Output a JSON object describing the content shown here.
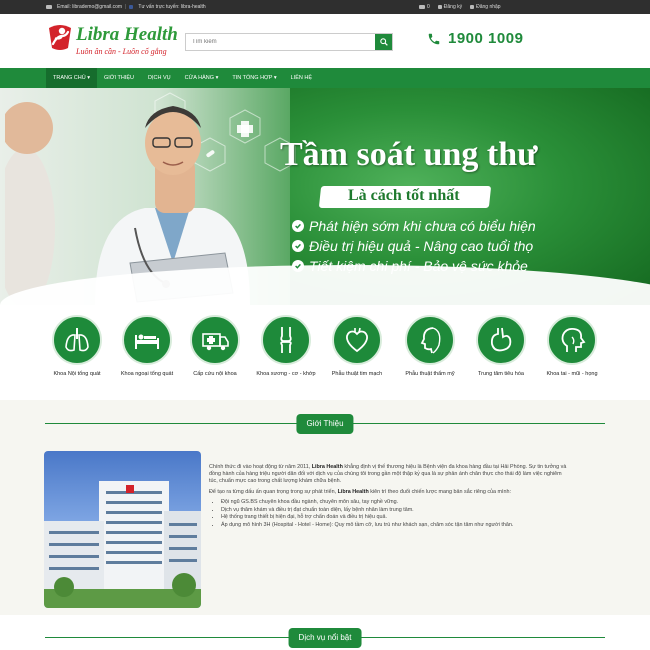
{
  "topbar": {
    "email": "Email: librademo@gmail.com",
    "separator": "|",
    "advice": "Tư vấn trực tuyến: libra-health",
    "cart_count": "0",
    "register": "Đăng ký",
    "login": "Đăng nhập"
  },
  "header": {
    "brand": "Libra Health",
    "slogan": "Luôn ân cần - Luôn cố gắng",
    "search_placeholder": "Tìm kiếm",
    "hotline": "1900 1009"
  },
  "nav": {
    "items": [
      "TRANG CHỦ",
      "GIỚI THIỆU",
      "DỊCH VỤ",
      "CỬA HÀNG",
      "TIN TỔNG HỢP",
      "LIÊN HỆ"
    ],
    "carets": [
      "▾",
      "",
      "",
      "▾",
      "▾",
      ""
    ]
  },
  "banner": {
    "title": "Tầm soát ung thư",
    "subtitle": "Là cách tốt nhất",
    "bullets": [
      "Phát hiện sớm khi chưa có biểu hiện",
      "Điều trị hiệu quả - Nâng cao tuổi thọ",
      "Tiết kiệm chi phí - Bảo vệ sức khỏe"
    ]
  },
  "departments": [
    {
      "label": "Khoa Nội tổng quát",
      "icon": "lungs-icon"
    },
    {
      "label": "Khoa ngoại tổng quát",
      "icon": "hospital-bed-icon"
    },
    {
      "label": "Cấp cứu nội khoa",
      "icon": "ambulance-icon"
    },
    {
      "label": "Khoa xương - cơ - khớp",
      "icon": "knee-joint-icon"
    },
    {
      "label": "Phẫu thuật tim mạch",
      "icon": "heart-icon"
    },
    {
      "label": "Phẫu thuật thẩm mỹ",
      "icon": "face-profile-icon"
    },
    {
      "label": "Trung tâm tiêu hóa",
      "icon": "stomach-icon"
    },
    {
      "label": "Khoa tai - mũi - họng",
      "icon": "ent-head-icon"
    }
  ],
  "intro": {
    "heading": "Giới Thiệu",
    "p1_before": "Chính thức đi vào hoạt động từ năm 2011, ",
    "p1_brand": "Libra Health",
    "p1_after": " khẳng định vị thế thương hiệu là Bệnh viện đa khoa hàng đầu tại Hải Phòng. Sự tin tưởng và đồng hành của hàng triệu người dân đối với dịch vụ của chúng tôi trong gần một thập kỷ qua là sự phản ánh chân thực cho thái độ làm việc nghiêm túc, chuẩn mực cao trong chất lượng khám chữa bệnh.",
    "p2_before": "Để tạo ra từng dấu ấn quan trọng trong sự phát triển, ",
    "p2_brand": "Libra Health",
    "p2_after": " kiên trì theo đuổi chiến lược mang bản sắc riêng của mình:",
    "list": [
      "Đội ngũ GS.BS chuyên khoa đầu ngành, chuyên môn sâu, tay nghề vững.",
      "Dịch vụ thăm khám và điều trị đạt chuẩn toàn diện, lấy bệnh nhân làm trung tâm.",
      "Hệ thống trang thiết bị hiện đại, hỗ trợ chẩn đoán và điều trị hiệu quả.",
      "Áp dụng mô hình 3H (Hospital - Hotel - Home): Quy mô tầm cỡ, lưu trú như khách sạn, chăm sóc tận tâm như người thân."
    ]
  },
  "services": {
    "heading": "Dịch vụ nổi bật"
  },
  "colors": {
    "brand_green": "#1f8a3b",
    "accent_red": "#d3232a"
  }
}
